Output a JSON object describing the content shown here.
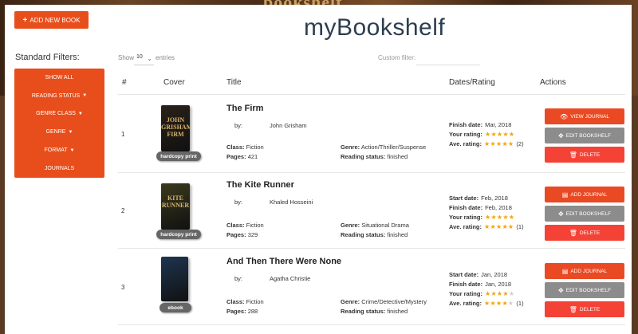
{
  "background_title": "bookshelf",
  "add_book_label": "ADD NEW BOOK",
  "app_title": "myBookshelf",
  "filters": {
    "title": "Standard Filters:",
    "items": [
      "SHOW ALL",
      "READING STATUS",
      "GENRE CLASS",
      "GENRE",
      "FORMAT",
      "JOURNALS"
    ]
  },
  "controls": {
    "show_label": "Show",
    "entries_value": "10",
    "entries_label": "entries",
    "custom_filter_label": "Custom filter:"
  },
  "table": {
    "headers": [
      "#",
      "Cover",
      "Title",
      "Dates/Rating",
      "Actions"
    ]
  },
  "labels": {
    "by": "by:",
    "class": "Class:",
    "pages": "Pages:",
    "genre": "Genre:",
    "reading_status": "Reading status:",
    "start_date": "Start date:",
    "finish_date": "Finish date:",
    "your_rating": "Your rating:",
    "ave_rating": "Ave. rating:",
    "view_journal": "VIEW JOURNAL",
    "add_journal": "ADD JOURNAL",
    "edit_bookshelf": "EDIT BOOKSHELF",
    "delete": "DELETE"
  },
  "books": [
    {
      "num": "1",
      "title": "The Firm",
      "author": "John Grisham",
      "format": "hardcopy print",
      "class": "Fiction",
      "pages": "421",
      "genre": "Action/Thriller/Suspense",
      "reading_status": "finished",
      "finish_date": "Mar, 2018",
      "your_rating": 5,
      "ave_rating": 5,
      "ave_count": "(2)",
      "journal_action": "VIEW JOURNAL",
      "cover_text": "JOHN GRISHAM FIRM",
      "cover_color": "#2a2118"
    },
    {
      "num": "2",
      "title": "The Kite Runner",
      "author": "Khaled Hosseini",
      "format": "hardcopy print",
      "class": "Fiction",
      "pages": "329",
      "genre": "Situational Drama",
      "reading_status": "finished",
      "start_date": "Feb, 2018",
      "finish_date": "Feb, 2018",
      "your_rating": 5,
      "ave_rating": 5,
      "ave_count": "(1)",
      "journal_action": "ADD JOURNAL",
      "cover_text": "KITE RUNNER",
      "cover_color": "#3b3a1e"
    },
    {
      "num": "3",
      "title": "And Then There Were None",
      "author": "Agatha Christie",
      "format": "ebook",
      "class": "Fiction",
      "pages": "288",
      "genre": "Crime/Detective/Mystery",
      "reading_status": "finished",
      "start_date": "Jan, 2018",
      "finish_date": "Jan, 2018",
      "your_rating": 4,
      "ave_rating": 4,
      "ave_count": "(1)",
      "journal_action": "ADD JOURNAL",
      "cover_text": "",
      "cover_color": "#1d3550"
    }
  ],
  "colors": {
    "accent": "#e84e1b",
    "edit": "#8c8c8c",
    "delete": "#f44336",
    "star": "#f5a300"
  }
}
